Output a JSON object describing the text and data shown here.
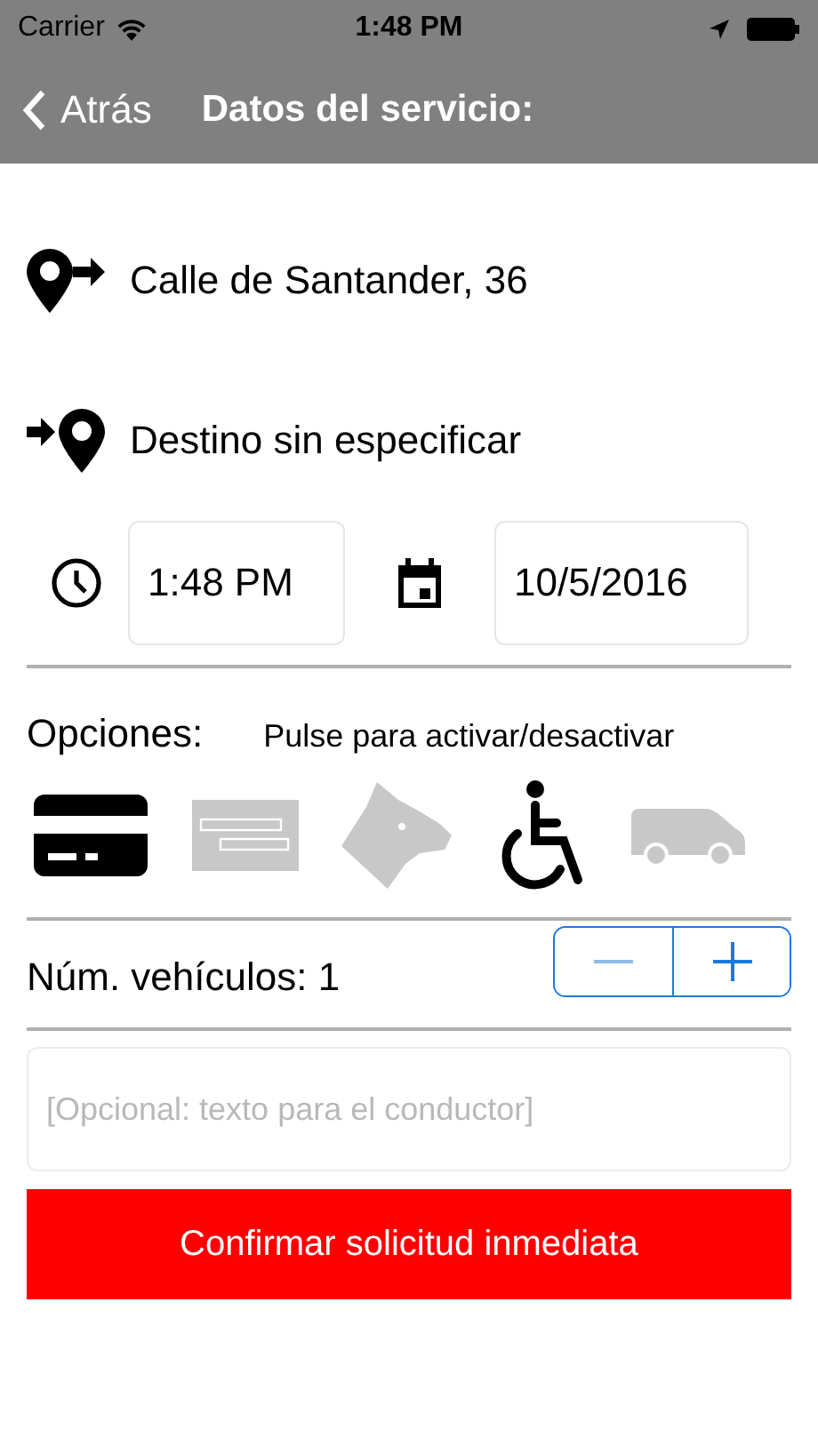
{
  "status_bar": {
    "carrier": "Carrier",
    "time": "1:48 PM"
  },
  "nav": {
    "back": "Atrás",
    "title": "Datos del servicio:"
  },
  "origin": "Calle de Santander, 36",
  "destination": "Destino sin especificar",
  "time": "1:48 PM",
  "date": "10/5/2016",
  "options": {
    "label": "Opciones:",
    "hint": "Pulse para activar/desactivar",
    "items": [
      {
        "kind": "card",
        "on": true
      },
      {
        "kind": "amex",
        "on": false
      },
      {
        "kind": "dog",
        "on": false
      },
      {
        "kind": "wheelchair",
        "on": true
      },
      {
        "kind": "van",
        "on": false
      }
    ]
  },
  "vehicles": {
    "label": "Núm. vehículos: 1",
    "minus_disabled": true
  },
  "note": {
    "placeholder": "[Opcional: texto para el conductor]"
  },
  "confirm": "Confirmar solicitud inmediata"
}
